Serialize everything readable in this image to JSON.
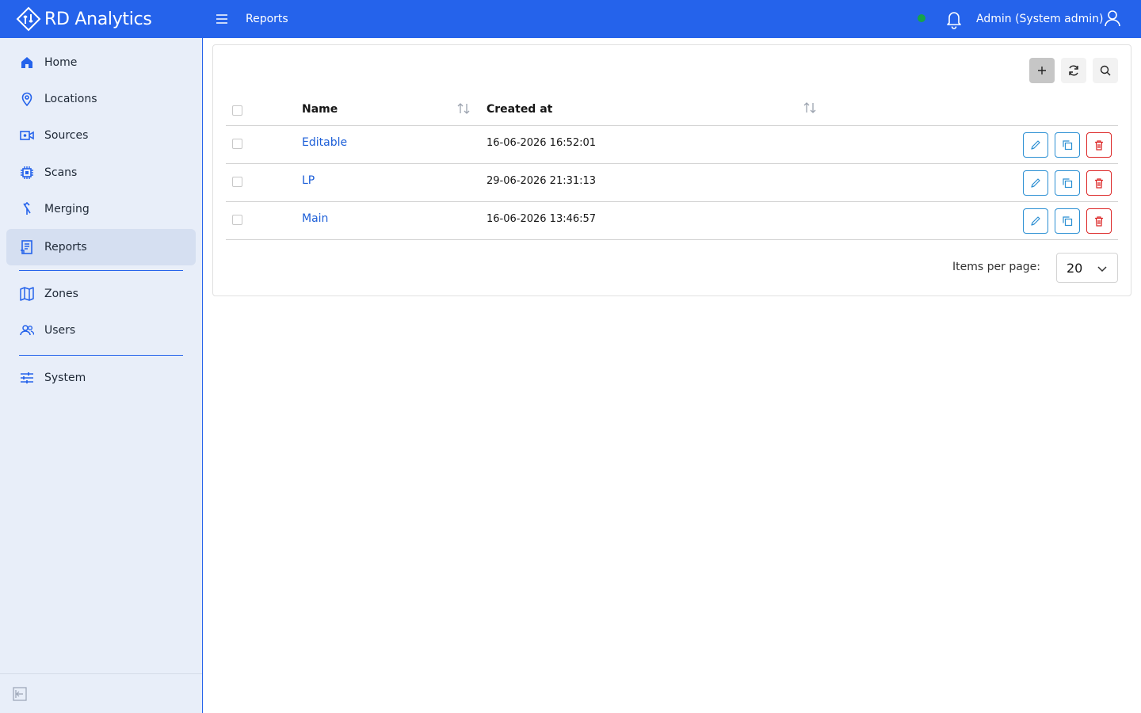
{
  "app": {
    "name": "RD Analytics"
  },
  "header": {
    "breadcrumb": "Reports",
    "user_label": "Admin (System admin)",
    "status_color": "#16a34a"
  },
  "colors": {
    "brand": "#2563eb",
    "link": "#1d5fd8",
    "danger": "#dc2626",
    "accent_action": "#2b8fd3"
  },
  "sidebar": {
    "items": [
      {
        "label": "Home",
        "icon": "home-icon"
      },
      {
        "label": "Locations",
        "icon": "map-pin-icon"
      },
      {
        "label": "Sources",
        "icon": "camera-icon"
      },
      {
        "label": "Scans",
        "icon": "chip-icon"
      },
      {
        "label": "Merging",
        "icon": "merge-icon"
      },
      {
        "label": "Reports",
        "icon": "report-icon",
        "active": true
      },
      {
        "label": "Zones",
        "icon": "map-icon"
      },
      {
        "label": "Users",
        "icon": "users-icon"
      },
      {
        "label": "System",
        "icon": "sliders-icon"
      }
    ]
  },
  "table": {
    "columns": [
      {
        "label": "Name",
        "sortable": true
      },
      {
        "label": "Created at",
        "sortable": true
      }
    ],
    "rows": [
      {
        "name": "Editable",
        "created_at": "16-06-2026 16:52:01"
      },
      {
        "name": "LP",
        "created_at": "29-06-2026 21:31:13"
      },
      {
        "name": "Main",
        "created_at": "16-06-2026 13:46:57"
      }
    ]
  },
  "pagination": {
    "items_per_page_label": "Items per page:",
    "items_per_page_value": "20"
  }
}
